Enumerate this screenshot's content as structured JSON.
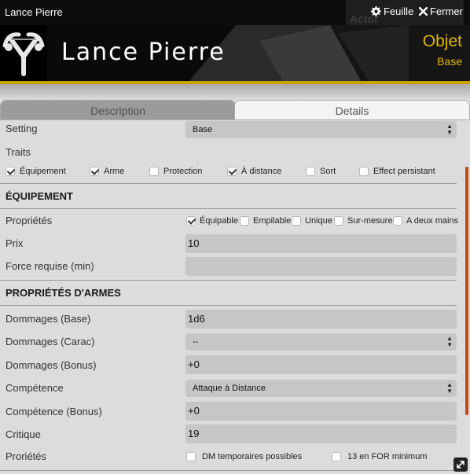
{
  "window": {
    "title": "Lance Pierre",
    "ghost_label": "Actor",
    "sheet_label": "Feuille",
    "close_label": "Fermer"
  },
  "header": {
    "name": "Lance Pierre",
    "type": "Objet",
    "subtype": "Base",
    "accent_color": "#e3b700"
  },
  "tabs": [
    {
      "label": "Description",
      "active": false
    },
    {
      "label": "Details",
      "active": true
    }
  ],
  "setting": {
    "label": "Setting",
    "value": "Base"
  },
  "traits": {
    "label": "Traits",
    "items": [
      {
        "label": "Équipement",
        "checked": true
      },
      {
        "label": "Arme",
        "checked": true
      },
      {
        "label": "Protection",
        "checked": false
      },
      {
        "label": "À distance",
        "checked": true
      },
      {
        "label": "Sort",
        "checked": false
      },
      {
        "label": "Effect persistant",
        "checked": false
      }
    ]
  },
  "equipment": {
    "title": "ÉQUIPEMENT",
    "properties_label": "Propriétés",
    "properties": [
      {
        "label": "Équipable",
        "checked": true
      },
      {
        "label": "Empilable",
        "checked": false
      },
      {
        "label": "Unique",
        "checked": false
      },
      {
        "label": "Sur-mesure",
        "checked": false
      },
      {
        "label": "A deux mains",
        "checked": false
      }
    ],
    "price_label": "Prix",
    "price_value": "10",
    "strength_label": "Force requise (min)",
    "strength_value": ""
  },
  "weapon": {
    "title": "PROPRIÉTÉS D'ARMES",
    "damage_base_label": "Dommages (Base)",
    "damage_base_value": "1d6",
    "damage_carac_label": "Dommages (Carac)",
    "damage_carac_value": "--",
    "damage_bonus_label": "Dommages (Bonus)",
    "damage_bonus_value": "+0",
    "skill_label": "Compétence",
    "skill_value": "Attaque à Distance",
    "skill_bonus_label": "Compétence (Bonus)",
    "skill_bonus_value": "+0",
    "critical_label": "Critique",
    "critical_value": "19",
    "props_label": "Proriétés",
    "props": [
      {
        "label": "DM temporaires possibles",
        "checked": false
      },
      {
        "label": "13 en FOR minimum",
        "checked": false
      }
    ]
  },
  "icons": {
    "sheet": "gear-icon",
    "close": "close-icon",
    "logo": "slingshot-icon",
    "resize": "resize-icon"
  }
}
